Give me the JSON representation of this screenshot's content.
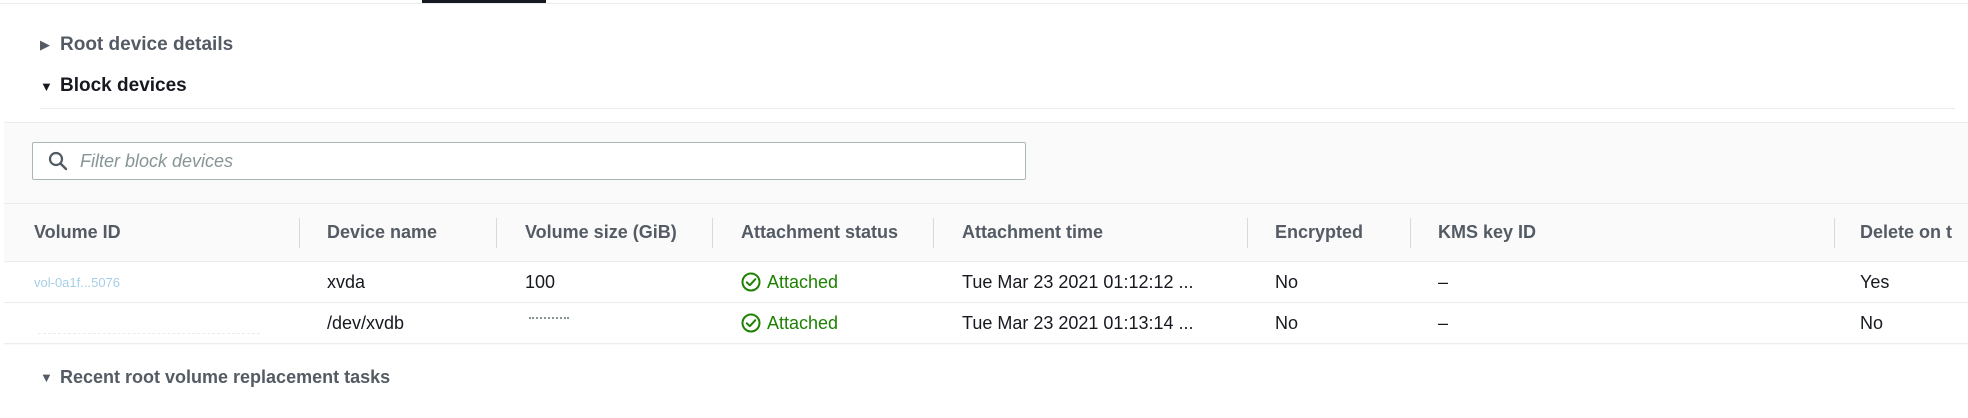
{
  "sections": {
    "root_device_details": "Root device details",
    "block_devices": "Block devices",
    "recent_tasks": "Recent root volume replacement tasks"
  },
  "filter": {
    "placeholder": "Filter block devices"
  },
  "table": {
    "columns": [
      "Volume ID",
      "Device name",
      "Volume size (GiB)",
      "Attachment status",
      "Attachment time",
      "Encrypted",
      "KMS key ID",
      "Delete on t"
    ],
    "rows": [
      {
        "volume_id": "vol-0a1f...5076",
        "device_name": "xvda",
        "volume_size": "100",
        "attachment_status": "Attached",
        "attachment_time": "Tue Mar 23 2021 01:12:12 ...",
        "encrypted": "No",
        "kms_key_id": "–",
        "delete_on_termination": "Yes"
      },
      {
        "volume_id": "",
        "device_name": "/dev/xvdb",
        "volume_size": "",
        "attachment_status": "Attached",
        "attachment_time": "Tue Mar 23 2021 01:13:14 ...",
        "encrypted": "No",
        "kms_key_id": "–",
        "delete_on_termination": "No"
      }
    ]
  },
  "colors": {
    "status_success": "#1d8102",
    "link": "#0073bb",
    "muted_text": "#545b64"
  },
  "icons": {
    "caret_collapsed": "caret-right-icon",
    "caret_expanded": "caret-down-icon",
    "search": "search-icon",
    "status": "check-circle-icon"
  }
}
